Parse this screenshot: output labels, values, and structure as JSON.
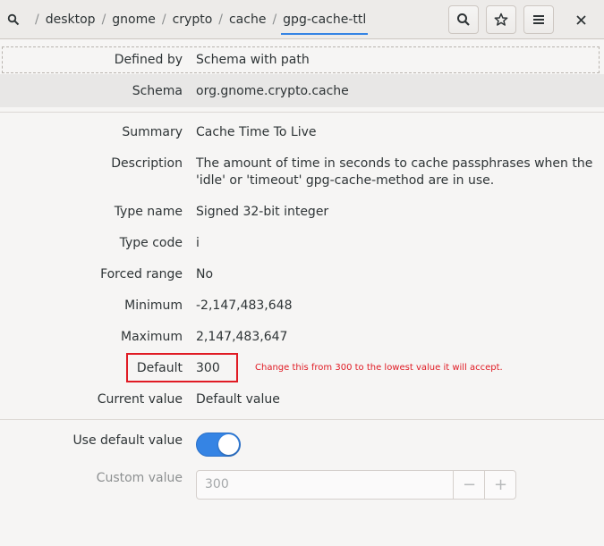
{
  "header": {
    "breadcrumbs": [
      "desktop",
      "gnome",
      "crypto",
      "cache",
      "gpg-cache-ttl"
    ]
  },
  "rows": {
    "defined_by": {
      "label": "Defined by",
      "value": "Schema with path"
    },
    "schema": {
      "label": "Schema",
      "value": "org.gnome.crypto.cache"
    },
    "summary": {
      "label": "Summary",
      "value": "Cache Time To Live"
    },
    "description": {
      "label": "Description",
      "line1": "The amount of time in seconds to cache passphrases when the",
      "line2": "'idle' or 'timeout' gpg-cache-method are in use."
    },
    "type_name": {
      "label": "Type name",
      "value": "Signed 32-bit integer"
    },
    "type_code": {
      "label": "Type code",
      "value": "i"
    },
    "forced_range": {
      "label": "Forced range",
      "value": "No"
    },
    "minimum": {
      "label": "Minimum",
      "value": "-2,147,483,648"
    },
    "maximum": {
      "label": "Maximum",
      "value": "2,147,483,647"
    },
    "default": {
      "label": "Default",
      "value": "300"
    },
    "current_value": {
      "label": "Current value",
      "value": "Default value"
    }
  },
  "annotation": "Change this from 300 to the lowest value it will accept.",
  "use_default": {
    "label": "Use default value",
    "state": "on"
  },
  "custom_value": {
    "label": "Custom value",
    "value": "300",
    "minus": "−",
    "plus": "+"
  },
  "colors": {
    "accent": "#3584e4",
    "annotation": "#e01b24"
  }
}
